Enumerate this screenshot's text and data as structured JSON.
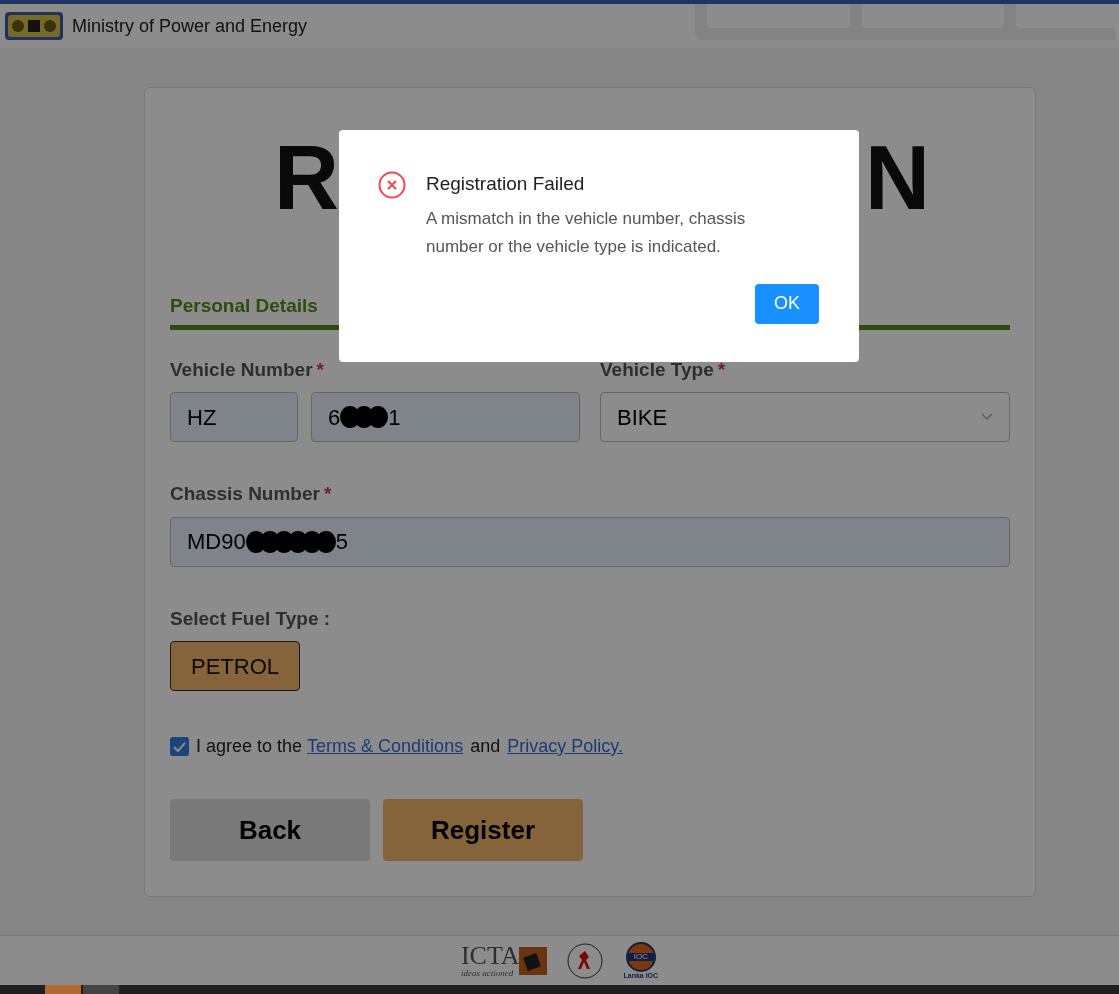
{
  "header": {
    "ministry": "Ministry of Power and Energy"
  },
  "form": {
    "title_start": "R",
    "title_end": "N",
    "tabs": [
      {
        "label": "Personal Details",
        "selected": true
      }
    ],
    "vehicle_number": {
      "label": "Vehicle Number",
      "required_mark": "*",
      "prefix": "HZ",
      "value_start": "6",
      "value_end": "1"
    },
    "vehicle_type": {
      "label": "Vehicle Type",
      "required_mark": "*",
      "value": "BIKE"
    },
    "chassis_number": {
      "label": "Chassis Number",
      "required_mark": "*",
      "value_start": "MD90",
      "value_end": "5"
    },
    "fuel": {
      "label": "Select Fuel Type :",
      "options": [
        {
          "label": "PETROL",
          "selected": true
        }
      ]
    },
    "agreement": {
      "checked": true,
      "text": "I agree to the",
      "terms": "Terms & Conditions",
      "and": "and",
      "privacy": "Privacy Policy."
    },
    "buttons": [
      {
        "label": "Back",
        "kind": "secondary"
      },
      {
        "label": "Register",
        "kind": "primary"
      }
    ]
  },
  "footer": {
    "icta": "ICTA",
    "icta_tagline": "ideas actioned",
    "ioc": "IOC",
    "ioc_caption": "Lanka IOC"
  },
  "dialog": {
    "title": "Registration Failed",
    "message": "A mismatch in the vehicle number, chassis number or the vehicle type is indicated.",
    "button": "OK"
  }
}
